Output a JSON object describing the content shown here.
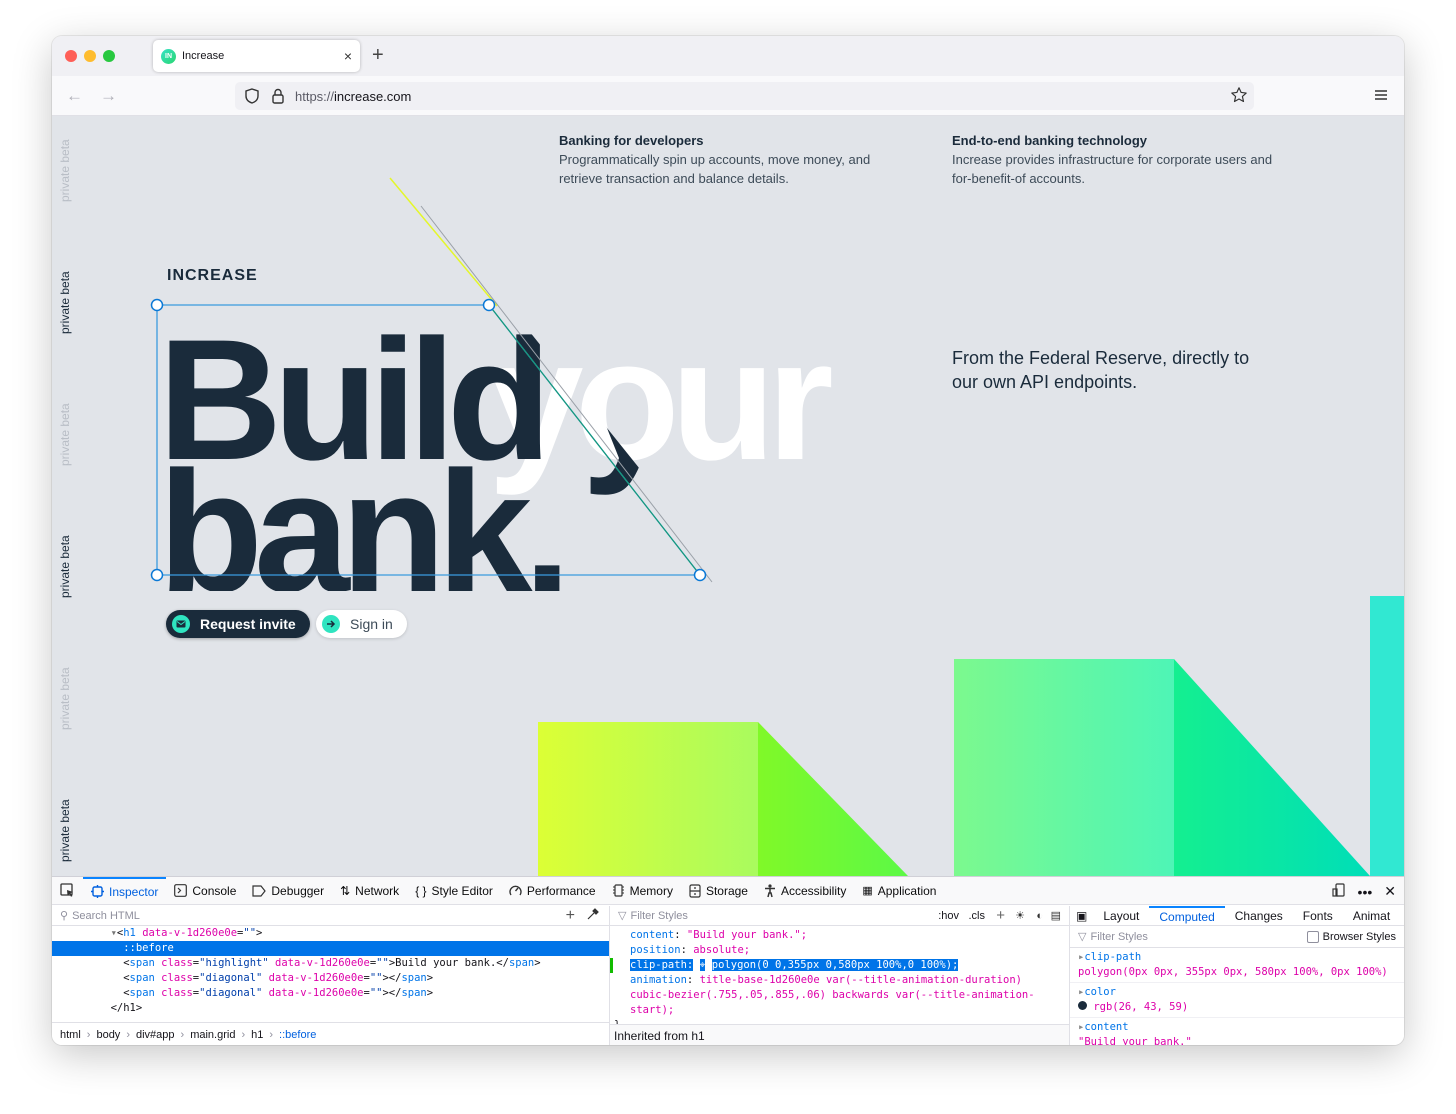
{
  "browser": {
    "tab_title": "Increase",
    "favicon_text": "IN",
    "url_protocol": "https://",
    "url_host": "increase.com",
    "new_tab_label": "+",
    "close_tab_label": "×"
  },
  "page": {
    "side_label": "private beta",
    "features": [
      {
        "title": "Banking for developers",
        "body": "Programmatically spin up accounts, move money, and retrieve transaction and balance details."
      },
      {
        "title": "End-to-end banking technology",
        "body": "Increase provides infrastructure for corporate users and for-benefit-of accounts."
      }
    ],
    "logo": "INCREASE",
    "hero": {
      "line1_dark": "Build y",
      "line1_white": "your",
      "line2": "bank."
    },
    "tagline": "From the Federal Reserve, directly to our own API endpoints.",
    "buttons": {
      "request_invite": "Request invite",
      "sign_in": "Sign in"
    },
    "accent_colors": {
      "dark": "#1a2b3b",
      "teal": "#2fe4c0",
      "lime": "#d8ff37",
      "green": "#0ee896"
    }
  },
  "devtools": {
    "tabs": [
      {
        "label": "Inspector",
        "icon": "inspector-icon"
      },
      {
        "label": "Console",
        "icon": "console-icon"
      },
      {
        "label": "Debugger",
        "icon": "debugger-icon"
      },
      {
        "label": "Network",
        "icon": "network-icon"
      },
      {
        "label": "Style Editor",
        "icon": "style-editor-icon"
      },
      {
        "label": "Performance",
        "icon": "performance-icon"
      },
      {
        "label": "Memory",
        "icon": "memory-icon"
      },
      {
        "label": "Storage",
        "icon": "storage-icon"
      },
      {
        "label": "Accessibility",
        "icon": "accessibility-icon"
      },
      {
        "label": "Application",
        "icon": "application-icon"
      }
    ],
    "search_html_placeholder": "Search HTML",
    "tree": {
      "h1_open_tag": "h1",
      "h1_attr": "data-v-1d260e0e",
      "before": "::before",
      "span1_class": "highlight",
      "span1_text": "Build your bank.",
      "span2_class": "diagonal",
      "span3_class": "diagonal",
      "h1_close": "</h1>"
    },
    "breadcrumbs": [
      "html",
      "body",
      "div#app",
      "main.grid",
      "h1",
      "::before"
    ],
    "rules": {
      "filter_placeholder": "Filter Styles",
      "hov": ":hov",
      "cls": ".cls",
      "content_prop": "content",
      "content_val": "\"Build your bank.\";",
      "position_prop": "position",
      "position_val": "absolute;",
      "clip_prop": "clip-path:",
      "clip_val": "polygon(0 0,355px 0,580px 100%,0 100%);",
      "animation_prop": "animation",
      "animation_val": "title-base-1d260e0e var(--title-animation-duration) cubic-bezier(.755,.05,.855,.06) backwards var(--title-animation-start);",
      "close_brace": "}",
      "inherited": "Inherited from h1"
    },
    "side_tabs": [
      "Layout",
      "Computed",
      "Changes",
      "Fonts",
      "Animat"
    ],
    "computed": {
      "filter_placeholder": "Filter Styles",
      "browser_styles_label": "Browser Styles",
      "browser_styles_checked": false,
      "items": [
        {
          "prop": "clip-path",
          "value": "polygon(0px 0px, 355px 0px, 580px 100%, 0px 100%)"
        },
        {
          "prop": "color",
          "value": "rgb(26, 43, 59)"
        },
        {
          "prop": "content",
          "value": "\"Build your bank.\""
        }
      ]
    }
  }
}
